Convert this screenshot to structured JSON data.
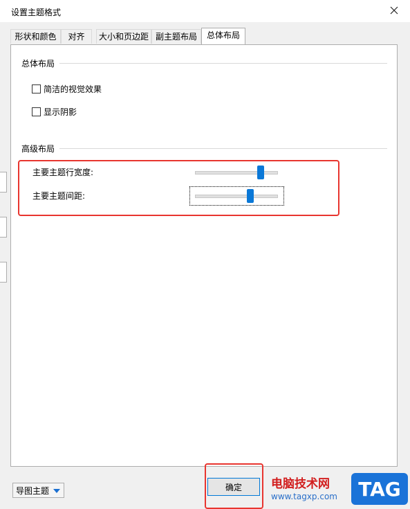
{
  "dialog": {
    "title": "设置主题格式"
  },
  "tabs": [
    {
      "label": "形状和颜色"
    },
    {
      "label": "对齐"
    },
    {
      "label": "大小和页边距"
    },
    {
      "label": "副主题布局"
    },
    {
      "label": "总体布局",
      "active": true
    }
  ],
  "layout_group": {
    "title": "总体布局",
    "options": [
      {
        "label": "简洁的视觉效果",
        "checked": false
      },
      {
        "label": "显示阴影",
        "checked": false
      }
    ]
  },
  "advanced_group": {
    "title": "高级布局",
    "sliders": [
      {
        "label": "主要主题行宽度:",
        "value": 0.82
      },
      {
        "label": "主要主题间距:",
        "value": 0.68
      }
    ]
  },
  "footer": {
    "theme_dropdown": "导图主题",
    "ok_label": "确定"
  },
  "watermark": {
    "text": "电脑技术网",
    "url": "www.tagxp.com",
    "badge": "TAG"
  },
  "colors": {
    "slider_thumb": "#0a78d7",
    "highlight": "#e8352f"
  }
}
